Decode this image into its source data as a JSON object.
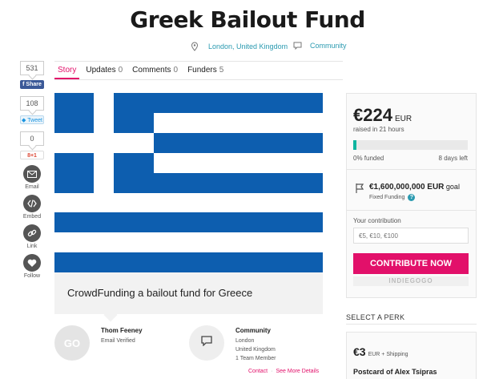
{
  "campaign": {
    "title": "Greek Bailout Fund",
    "location": "London, United Kingdom",
    "category": "Community"
  },
  "share": {
    "facebook_count": "531",
    "facebook_label": "Share",
    "twitter_count": "108",
    "twitter_label": "Tweet",
    "gplus_count": "0",
    "gplus_label": "8+1",
    "actions": [
      {
        "label": "Email",
        "icon": "envelope-icon"
      },
      {
        "label": "Embed",
        "icon": "code-icon"
      },
      {
        "label": "Link",
        "icon": "link-icon"
      },
      {
        "label": "Follow",
        "icon": "heart-icon"
      }
    ]
  },
  "tabs": [
    {
      "label": "Story",
      "count": "",
      "active": true
    },
    {
      "label": "Updates",
      "count": "0"
    },
    {
      "label": "Comments",
      "count": "0"
    },
    {
      "label": "Funders",
      "count": "5"
    }
  ],
  "story": {
    "caption": "CrowdFunding a bailout fund for Greece"
  },
  "owner": {
    "name": "Thom Feeney",
    "status": "Email Verified",
    "avatar_text": "GO"
  },
  "team": {
    "name": "Community",
    "city": "London",
    "country": "United Kingdom",
    "members": "1 Team Member"
  },
  "links": {
    "contact": "Contact",
    "details": "See More Details"
  },
  "funding": {
    "amount": "€224",
    "currency": "EUR",
    "raised_time": "raised in 21 hours",
    "progress_fraction": 0.0,
    "funded_text": "0% funded",
    "time_left": "8 days left",
    "goal_amount": "€1,600,000,000 EUR",
    "goal_suffix": "goal",
    "funding_type": "Fixed Funding",
    "contribution_label": "Your contribution",
    "contribution_placeholder": "€5, €10, €100",
    "contribute_button": "CONTRIBUTE NOW",
    "brand": "INDIEGOGO"
  },
  "perks": {
    "heading": "SELECT A PERK",
    "items": [
      {
        "price": "€3",
        "price_note": "EUR + Shipping",
        "name": "Postcard of Alex Tsipras"
      }
    ]
  },
  "colors": {
    "accent": "#e2106a",
    "link": "#2a9ab0",
    "progress": "#0fb5a0",
    "flag_blue": "#0d5eaf"
  }
}
